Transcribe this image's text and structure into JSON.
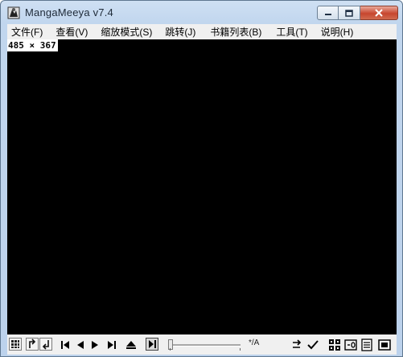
{
  "window": {
    "title": "MangaMeeya v7.4"
  },
  "menu": [
    {
      "label": "文件(F)"
    },
    {
      "label": "查看(V)"
    },
    {
      "label": "缩放模式(S)"
    },
    {
      "label": "跳转(J)"
    },
    {
      "label": "书籍列表(B)"
    },
    {
      "label": "工具(T)"
    },
    {
      "label": "说明(H)"
    }
  ],
  "viewer": {
    "dimensions": "485 × 367",
    "background": "#000000"
  },
  "toolbar": {
    "zoom_label": "*/A",
    "slider_position": 0.0,
    "icons": [
      "thumbnail-grid-icon",
      "rotate-left-icon",
      "rotate-right-icon",
      "first-page-icon",
      "previous-page-icon",
      "next-page-icon",
      "last-page-icon",
      "eject-icon",
      "play-icon",
      "fit-arrow-icon",
      "check-icon",
      "grid-view-icon",
      "page-zero-icon",
      "page-list-icon",
      "fullscreen-icon"
    ]
  }
}
